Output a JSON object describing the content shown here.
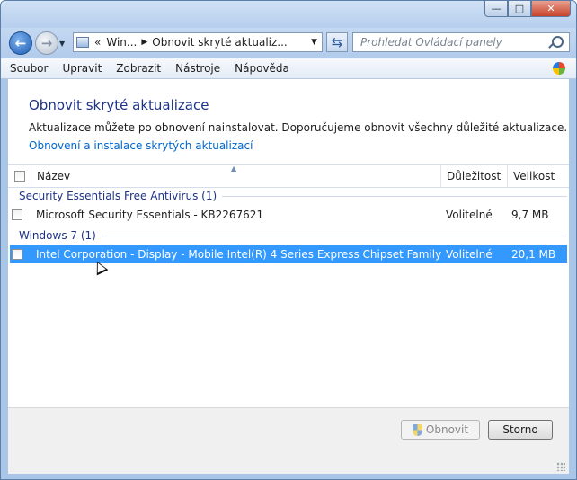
{
  "window": {
    "caption_buttons": {
      "minimize": "—",
      "maximize": "□",
      "close": "✕"
    }
  },
  "nav": {
    "back_icon": "back-arrow-icon",
    "forward_icon": "forward-arrow-icon",
    "breadcrumb_overflow": "«",
    "breadcrumb": [
      "Win...",
      "Obnovit skryté aktualiz..."
    ],
    "search_placeholder": "Prohledat Ovládací panely"
  },
  "menu": {
    "items": [
      "Soubor",
      "Upravit",
      "Zobrazit",
      "Nástroje",
      "Nápověda"
    ]
  },
  "page": {
    "title": "Obnovit skryté aktualizace",
    "description": "Aktualizace můžete po obnovení nainstalovat. Doporučujeme obnovit všechny důležité aktualizace.",
    "link": "Obnovení a instalace skrytých aktualizací"
  },
  "list": {
    "columns": {
      "name": "Název",
      "importance": "Důležitost",
      "size": "Velikost"
    },
    "groups": [
      {
        "title": "Security Essentials Free Antivirus (1)",
        "rows": [
          {
            "name": "Microsoft Security Essentials - KB2267621",
            "importance": "Volitelné",
            "size": "9,7 MB",
            "selected": false
          }
        ]
      },
      {
        "title": "Windows 7 (1)",
        "rows": [
          {
            "name": "Intel Corporation - Display - Mobile Intel(R) 4 Series Express Chipset Family",
            "importance": "Volitelné",
            "size": "20,1 MB",
            "selected": true
          }
        ]
      }
    ]
  },
  "footer": {
    "restore_label": "Obnovit",
    "cancel_label": "Storno"
  },
  "colors": {
    "accent_heading": "#1e3287",
    "link": "#0066cc",
    "selection": "#3399ff"
  }
}
